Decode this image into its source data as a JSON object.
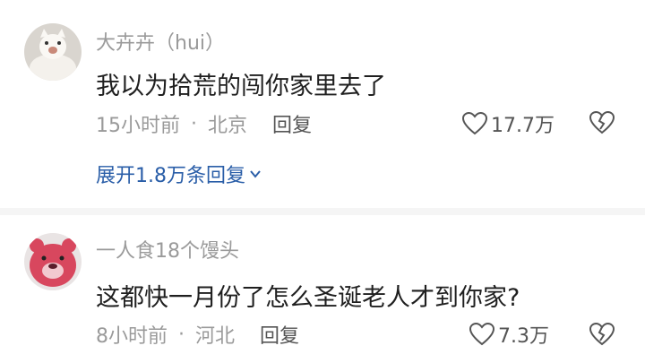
{
  "comments": [
    {
      "username": "大卉卉（hui）",
      "content": "我以为拾荒的闯你家里去了",
      "time": "15小时前",
      "separator": "·",
      "location": "北京",
      "reply_label": "回复",
      "likes": "17.7万",
      "expand_replies": "展开1.8万条回复"
    },
    {
      "username": "一人食18个馒头",
      "content": "这都快一月份了怎么圣诞老人才到你家?",
      "time": "8小时前",
      "separator": "·",
      "location": "河北",
      "reply_label": "回复",
      "likes": "7.3万"
    }
  ],
  "colors": {
    "link": "#2a5ea8",
    "secondary_text": "#9a9a9a",
    "primary_text": "#1f1f1f",
    "divider": "#f5f5f5"
  },
  "icons": [
    "heart-outline-icon",
    "broken-heart-icon",
    "chevron-down-icon"
  ]
}
